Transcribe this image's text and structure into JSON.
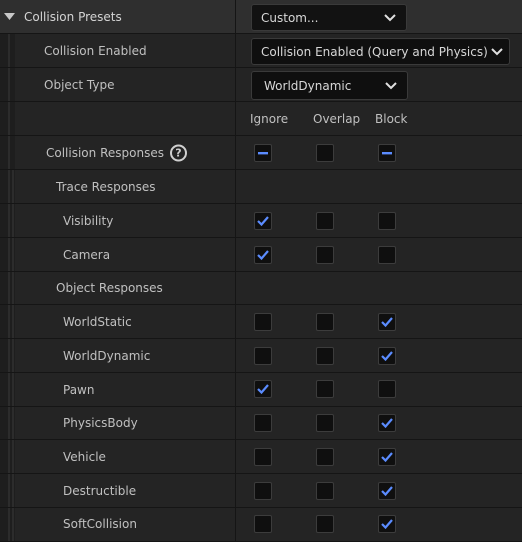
{
  "section": {
    "title": "Collision Presets",
    "preset_value": "Custom..."
  },
  "collision_enabled": {
    "label": "Collision Enabled",
    "value": "Collision Enabled (Query and Physics)"
  },
  "object_type": {
    "label": "Object Type",
    "value": "WorldDynamic"
  },
  "columns": {
    "ignore": "Ignore",
    "overlap": "Overlap",
    "block": "Block"
  },
  "collision_responses": {
    "label": "Collision Responses",
    "help_glyph": "?",
    "ignore": "mixed",
    "overlap": "unchecked",
    "block": "mixed"
  },
  "trace_responses": {
    "label": "Trace Responses",
    "items": [
      {
        "label": "Visibility",
        "ignore": true,
        "overlap": false,
        "block": false
      },
      {
        "label": "Camera",
        "ignore": true,
        "overlap": false,
        "block": false
      }
    ]
  },
  "object_responses": {
    "label": "Object Responses",
    "items": [
      {
        "label": "WorldStatic",
        "ignore": false,
        "overlap": false,
        "block": true
      },
      {
        "label": "WorldDynamic",
        "ignore": false,
        "overlap": false,
        "block": true
      },
      {
        "label": "Pawn",
        "ignore": true,
        "overlap": false,
        "block": false
      },
      {
        "label": "PhysicsBody",
        "ignore": false,
        "overlap": false,
        "block": true
      },
      {
        "label": "Vehicle",
        "ignore": false,
        "overlap": false,
        "block": true
      },
      {
        "label": "Destructible",
        "ignore": false,
        "overlap": false,
        "block": true
      },
      {
        "label": "SoftCollision",
        "ignore": false,
        "overlap": false,
        "block": true
      }
    ]
  },
  "colors": {
    "check": "#5b8cff",
    "background": "#242424",
    "header_background": "#2f2f2f"
  }
}
